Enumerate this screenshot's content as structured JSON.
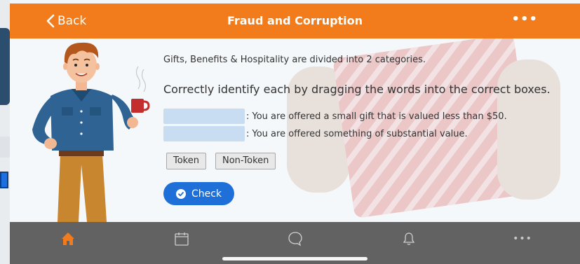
{
  "header": {
    "back_label": "Back",
    "title": "Fraud and Corruption",
    "more_label": "•••"
  },
  "content": {
    "intro": "Gifts, Benefits & Hospitality are divided into 2 categories.",
    "instruction": "Correctly identify each by dragging the words into the correct boxes.",
    "rows": [
      {
        "text": ": You are offered a small gift that is valued less than $50."
      },
      {
        "text": ": You are offered something of substantial value."
      }
    ],
    "chips": [
      "Token",
      "Non-Token"
    ],
    "check_label": "Check"
  },
  "tabbar": {
    "items": [
      {
        "icon": "home-icon",
        "active": true
      },
      {
        "icon": "calendar-icon",
        "active": false
      },
      {
        "icon": "chat-icon",
        "active": false
      },
      {
        "icon": "bell-icon",
        "active": false
      },
      {
        "icon": "more-icon",
        "active": false
      }
    ],
    "more_label": "•••"
  },
  "colors": {
    "accent": "#f27c1b",
    "primary_button": "#1f6fd8",
    "tabbar": "#626262",
    "drop_box": "#c8dcf2"
  }
}
